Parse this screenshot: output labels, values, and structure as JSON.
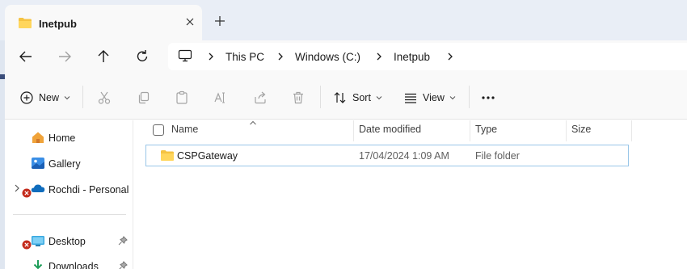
{
  "window": {
    "tab_title": "Inetpub"
  },
  "address_bar": {
    "crumbs": [
      "This PC",
      "Windows (C:)",
      "Inetpub"
    ]
  },
  "toolbar": {
    "new_label": "New",
    "sort_label": "Sort",
    "view_label": "View"
  },
  "sidebar": {
    "items": [
      {
        "label": "Home",
        "icon": "home-icon"
      },
      {
        "label": "Gallery",
        "icon": "gallery-icon"
      },
      {
        "label": "Rochdi - Personal",
        "icon": "onedrive-icon"
      },
      {
        "label": "Desktop",
        "icon": "desktop-icon"
      },
      {
        "label": "Downloads",
        "icon": "downloads-icon"
      }
    ]
  },
  "table": {
    "columns": [
      "Name",
      "Date modified",
      "Type",
      "Size"
    ],
    "rows": [
      {
        "name": "CSPGateway",
        "date_modified": "17/04/2024 1:09 AM",
        "type": "File folder",
        "size": ""
      }
    ]
  },
  "colors": {
    "folder_yellow": "#f5c342",
    "accent_blue": "#0067c0",
    "selection_border": "#99c6e8",
    "error_red": "#c42b1c"
  }
}
